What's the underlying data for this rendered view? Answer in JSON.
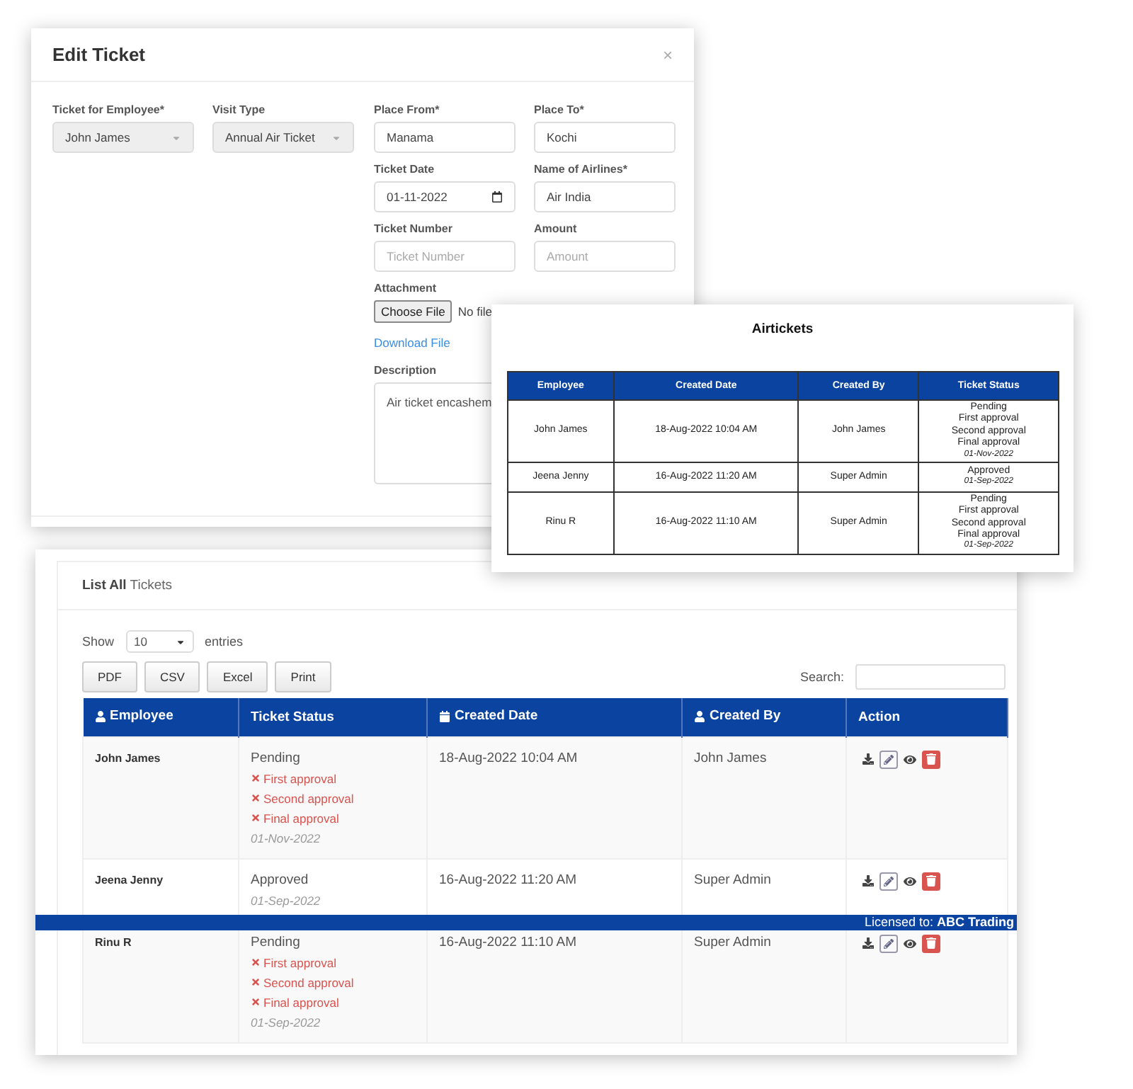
{
  "edit_ticket": {
    "title": "Edit Ticket",
    "close": "×",
    "fields": [
      {
        "kind": "select",
        "label": "Ticket for Employee*",
        "value": "John James"
      },
      {
        "kind": "select",
        "label": "Visit Type",
        "value": "Annual Air Ticket"
      },
      {
        "kind": "input",
        "label": "Place From*",
        "value": "Manama"
      },
      {
        "kind": "input",
        "label": "Place To*",
        "value": "Kochi"
      },
      {
        "kind": "date",
        "label": "Ticket Date",
        "value": "01-11-2022"
      },
      {
        "kind": "input",
        "label": "Name of Airlines*",
        "value": "Air India"
      },
      {
        "kind": "input",
        "label": "Ticket Number",
        "placeholder": "Ticket Number"
      },
      {
        "kind": "input",
        "label": "Amount",
        "placeholder": "Amount"
      },
      {
        "kind": "file",
        "label": "Attachment",
        "button": "Choose File",
        "status": "No file",
        "link": "Download File"
      },
      {
        "kind": "textarea",
        "label": "Description",
        "value": "Air ticket encashem"
      }
    ]
  },
  "airtickets": {
    "title": "Airtickets",
    "columns": [
      "Employee",
      "Created Date",
      "Created By",
      "Ticket Status"
    ],
    "rows": [
      {
        "employee": "John James",
        "created_date": "18-Aug-2022 10:04 AM",
        "created_by": "John James",
        "status_lines": [
          "Pending",
          "First approval",
          "Second approval",
          "Final approval"
        ],
        "date": "01-Nov-2022"
      },
      {
        "employee": "Jeena Jenny",
        "created_date": "16-Aug-2022 11:20 AM",
        "created_by": "Super Admin",
        "status_lines": [
          "Approved"
        ],
        "date": "01-Sep-2022"
      },
      {
        "employee": "Rinu R",
        "created_date": "16-Aug-2022 11:10 AM",
        "created_by": "Super Admin",
        "status_lines": [
          "Pending",
          "First approval",
          "Second approval",
          "Final approval"
        ],
        "date": "01-Sep-2022"
      }
    ]
  },
  "list": {
    "title": "**List All** Tickets",
    "show_label": "Show",
    "page_size": "10",
    "entries_label": "entries",
    "buttons": [
      "PDF",
      "CSV",
      "Excel",
      "Print"
    ],
    "search_label": "Search:",
    "columns": [
      {
        "label": "Employee",
        "kind": "person"
      },
      {
        "label": "Ticket Status",
        "kind": "text"
      },
      {
        "label": "Created Date",
        "kind": "date"
      },
      {
        "label": "Created By",
        "kind": "person"
      },
      {
        "label": "Action",
        "kind": "text"
      }
    ],
    "rows": [
      {
        "employee": "John James",
        "status": "Pending",
        "approvals": [
          {
            "label": "First approval",
            "approved": false
          },
          {
            "label": "Second approval",
            "approved": false
          },
          {
            "label": "Final approval",
            "approved": false
          }
        ],
        "date": "01-Nov-2022",
        "created_date": "18-Aug-2022 10:04 AM",
        "created_by": "John James"
      },
      {
        "employee": "Jeena Jenny",
        "status": "Approved",
        "approvals": [],
        "date": "01-Sep-2022",
        "created_date": "16-Aug-2022 11:20 AM",
        "created_by": "Super Admin"
      },
      {
        "employee": "Rinu R",
        "status": "Pending",
        "approvals": [
          {
            "label": "First approval",
            "approved": false
          },
          {
            "label": "Second approval",
            "approved": false
          },
          {
            "label": "Final approval",
            "approved": false
          }
        ],
        "date": "01-Sep-2022",
        "created_date": "16-Aug-2022 11:10 AM",
        "created_by": "Super Admin"
      }
    ]
  },
  "license_bar": {
    "text": "Licensed to: **ABC Trading**"
  }
}
